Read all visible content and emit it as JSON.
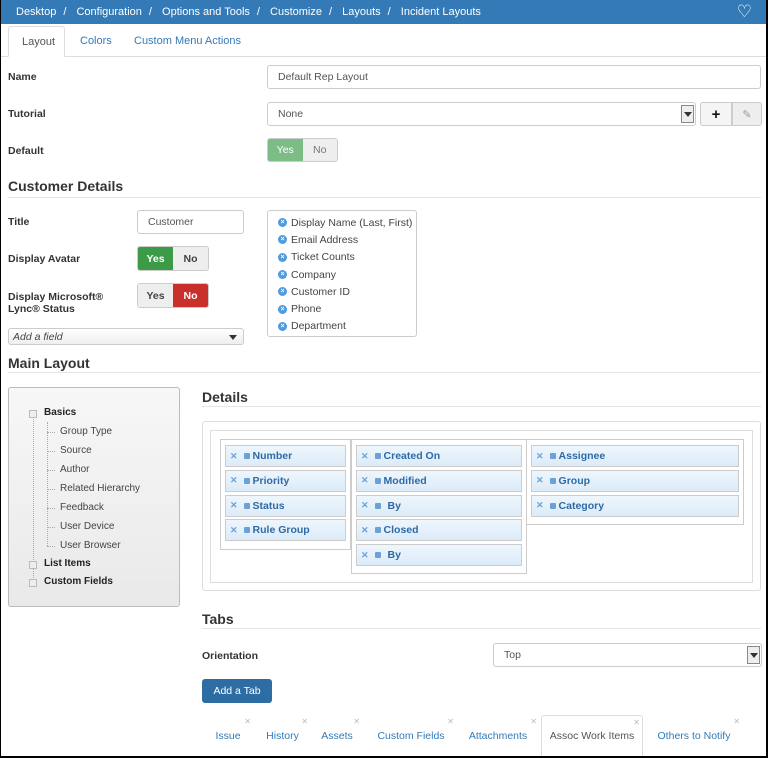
{
  "breadcrumb": [
    "Desktop",
    "Configuration",
    "Options and Tools",
    "Customize",
    "Layouts",
    "Incident Layouts"
  ],
  "tabs": [
    {
      "label": "Layout",
      "active": true
    },
    {
      "label": "Colors"
    },
    {
      "label": "Custom Menu Actions"
    }
  ],
  "form": {
    "name_label": "Name",
    "name_value": "Default Rep Layout",
    "tutorial_label": "Tutorial",
    "tutorial_value": "None",
    "default_label": "Default",
    "default_yes": "Yes",
    "default_no": "No",
    "default_selected": "Yes"
  },
  "customer": {
    "heading": "Customer Details",
    "title_label": "Title",
    "title_value": "Customer",
    "avatar_label": "Display Avatar",
    "avatar_yes": "Yes",
    "avatar_no": "No",
    "avatar_selected": "Yes",
    "lync_label": "Display Microsoft® Lync® Status",
    "lync_yes": "Yes",
    "lync_no": "No",
    "lync_selected": "No",
    "add_field_placeholder": "Add a field",
    "fields": [
      "Display Name (Last, First)",
      "Email Address",
      "Ticket Counts",
      "Company",
      "Customer ID",
      "Phone",
      "Department"
    ]
  },
  "main": {
    "heading": "Main Layout",
    "tree": {
      "basics": "Basics",
      "basics_children": [
        "Group Type",
        "Source",
        "Author",
        "Related Hierarchy",
        "Feedback",
        "User Device",
        "User Browser"
      ],
      "list_items": "List Items",
      "custom_fields": "Custom Fields"
    },
    "details_heading": "Details",
    "columns": [
      [
        "Number",
        "Priority",
        "Status",
        "Rule Group"
      ],
      [
        "Created On",
        "Modified",
        "By",
        "Closed",
        "By"
      ],
      [
        "Assignee",
        "Group",
        "Category"
      ]
    ]
  },
  "tabs_section": {
    "heading": "Tabs",
    "orientation_label": "Orientation",
    "orientation_value": "Top",
    "add_tab": "Add a Tab",
    "tabs": [
      "Issue",
      "History",
      "Assets",
      "Custom Fields",
      "Attachments",
      "Assoc Work Items",
      "Others to Notify"
    ],
    "active_tab": "Assoc Work Items"
  },
  "colors": {
    "topbar": "#337ab7",
    "yes_green": "#3d9a47",
    "default_yes": "#7cbd85",
    "no_red": "#c9302c",
    "button_blue": "#2e6da4"
  }
}
